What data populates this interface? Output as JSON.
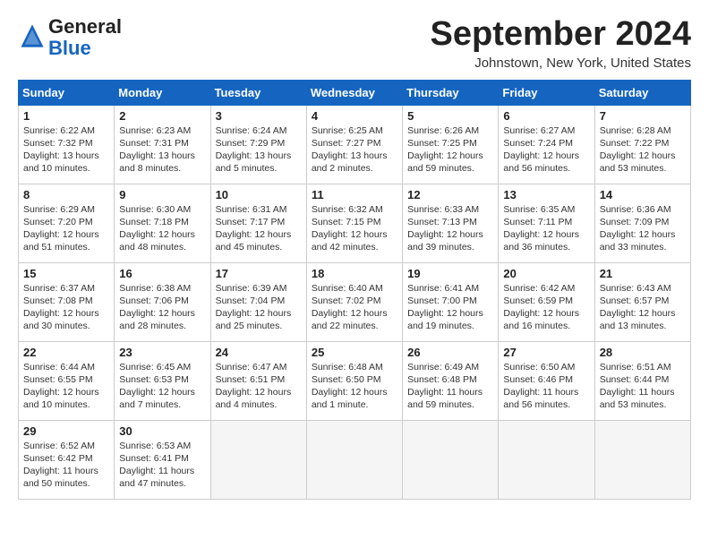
{
  "header": {
    "logo_line1": "General",
    "logo_line2": "Blue",
    "month_title": "September 2024",
    "location": "Johnstown, New York, United States"
  },
  "columns": [
    "Sunday",
    "Monday",
    "Tuesday",
    "Wednesday",
    "Thursday",
    "Friday",
    "Saturday"
  ],
  "weeks": [
    [
      {
        "day": "1",
        "info": "Sunrise: 6:22 AM\nSunset: 7:32 PM\nDaylight: 13 hours\nand 10 minutes."
      },
      {
        "day": "2",
        "info": "Sunrise: 6:23 AM\nSunset: 7:31 PM\nDaylight: 13 hours\nand 8 minutes."
      },
      {
        "day": "3",
        "info": "Sunrise: 6:24 AM\nSunset: 7:29 PM\nDaylight: 13 hours\nand 5 minutes."
      },
      {
        "day": "4",
        "info": "Sunrise: 6:25 AM\nSunset: 7:27 PM\nDaylight: 13 hours\nand 2 minutes."
      },
      {
        "day": "5",
        "info": "Sunrise: 6:26 AM\nSunset: 7:25 PM\nDaylight: 12 hours\nand 59 minutes."
      },
      {
        "day": "6",
        "info": "Sunrise: 6:27 AM\nSunset: 7:24 PM\nDaylight: 12 hours\nand 56 minutes."
      },
      {
        "day": "7",
        "info": "Sunrise: 6:28 AM\nSunset: 7:22 PM\nDaylight: 12 hours\nand 53 minutes."
      }
    ],
    [
      {
        "day": "8",
        "info": "Sunrise: 6:29 AM\nSunset: 7:20 PM\nDaylight: 12 hours\nand 51 minutes."
      },
      {
        "day": "9",
        "info": "Sunrise: 6:30 AM\nSunset: 7:18 PM\nDaylight: 12 hours\nand 48 minutes."
      },
      {
        "day": "10",
        "info": "Sunrise: 6:31 AM\nSunset: 7:17 PM\nDaylight: 12 hours\nand 45 minutes."
      },
      {
        "day": "11",
        "info": "Sunrise: 6:32 AM\nSunset: 7:15 PM\nDaylight: 12 hours\nand 42 minutes."
      },
      {
        "day": "12",
        "info": "Sunrise: 6:33 AM\nSunset: 7:13 PM\nDaylight: 12 hours\nand 39 minutes."
      },
      {
        "day": "13",
        "info": "Sunrise: 6:35 AM\nSunset: 7:11 PM\nDaylight: 12 hours\nand 36 minutes."
      },
      {
        "day": "14",
        "info": "Sunrise: 6:36 AM\nSunset: 7:09 PM\nDaylight: 12 hours\nand 33 minutes."
      }
    ],
    [
      {
        "day": "15",
        "info": "Sunrise: 6:37 AM\nSunset: 7:08 PM\nDaylight: 12 hours\nand 30 minutes."
      },
      {
        "day": "16",
        "info": "Sunrise: 6:38 AM\nSunset: 7:06 PM\nDaylight: 12 hours\nand 28 minutes."
      },
      {
        "day": "17",
        "info": "Sunrise: 6:39 AM\nSunset: 7:04 PM\nDaylight: 12 hours\nand 25 minutes."
      },
      {
        "day": "18",
        "info": "Sunrise: 6:40 AM\nSunset: 7:02 PM\nDaylight: 12 hours\nand 22 minutes."
      },
      {
        "day": "19",
        "info": "Sunrise: 6:41 AM\nSunset: 7:00 PM\nDaylight: 12 hours\nand 19 minutes."
      },
      {
        "day": "20",
        "info": "Sunrise: 6:42 AM\nSunset: 6:59 PM\nDaylight: 12 hours\nand 16 minutes."
      },
      {
        "day": "21",
        "info": "Sunrise: 6:43 AM\nSunset: 6:57 PM\nDaylight: 12 hours\nand 13 minutes."
      }
    ],
    [
      {
        "day": "22",
        "info": "Sunrise: 6:44 AM\nSunset: 6:55 PM\nDaylight: 12 hours\nand 10 minutes."
      },
      {
        "day": "23",
        "info": "Sunrise: 6:45 AM\nSunset: 6:53 PM\nDaylight: 12 hours\nand 7 minutes."
      },
      {
        "day": "24",
        "info": "Sunrise: 6:47 AM\nSunset: 6:51 PM\nDaylight: 12 hours\nand 4 minutes."
      },
      {
        "day": "25",
        "info": "Sunrise: 6:48 AM\nSunset: 6:50 PM\nDaylight: 12 hours\nand 1 minute."
      },
      {
        "day": "26",
        "info": "Sunrise: 6:49 AM\nSunset: 6:48 PM\nDaylight: 11 hours\nand 59 minutes."
      },
      {
        "day": "27",
        "info": "Sunrise: 6:50 AM\nSunset: 6:46 PM\nDaylight: 11 hours\nand 56 minutes."
      },
      {
        "day": "28",
        "info": "Sunrise: 6:51 AM\nSunset: 6:44 PM\nDaylight: 11 hours\nand 53 minutes."
      }
    ],
    [
      {
        "day": "29",
        "info": "Sunrise: 6:52 AM\nSunset: 6:42 PM\nDaylight: 11 hours\nand 50 minutes."
      },
      {
        "day": "30",
        "info": "Sunrise: 6:53 AM\nSunset: 6:41 PM\nDaylight: 11 hours\nand 47 minutes."
      },
      {
        "day": "",
        "info": ""
      },
      {
        "day": "",
        "info": ""
      },
      {
        "day": "",
        "info": ""
      },
      {
        "day": "",
        "info": ""
      },
      {
        "day": "",
        "info": ""
      }
    ]
  ]
}
